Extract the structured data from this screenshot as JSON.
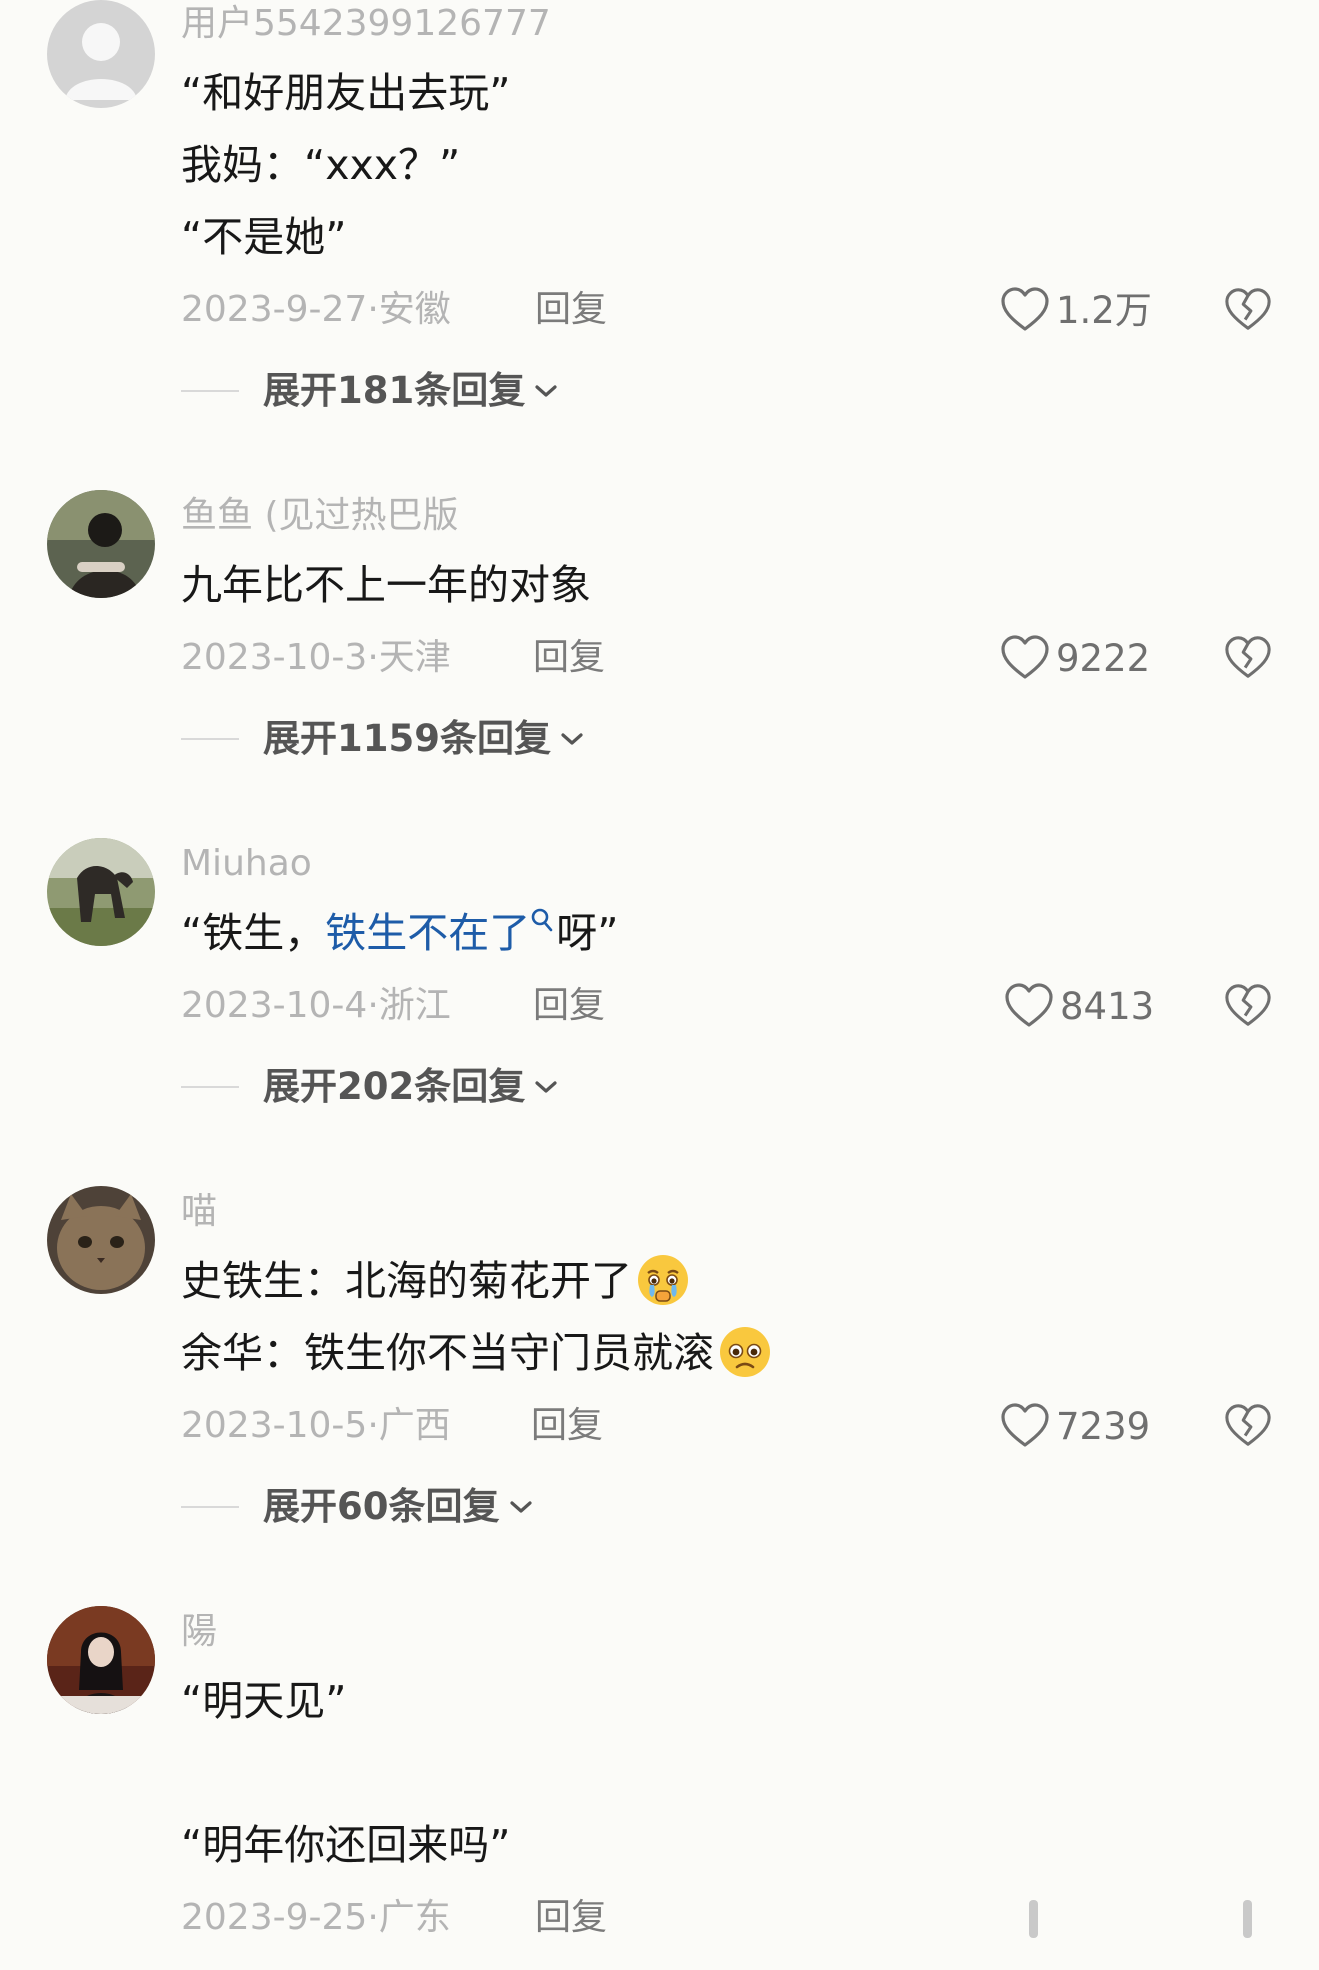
{
  "comments": [
    {
      "username": "用户5542399126777",
      "lines": [
        "“和好朋友出去玩”",
        "我妈：“xxx？”",
        "“不是她”"
      ],
      "date": "2023-9-27",
      "location": "安徽",
      "reply_label": "回复",
      "likes": "1.2万",
      "expand_label": "展开181条回复"
    },
    {
      "username": "鱼鱼 (见过热巴版",
      "lines": [
        "九年比不上一年的对象"
      ],
      "date": "2023-10-3",
      "location": "天津",
      "reply_label": "回复",
      "likes": "9222",
      "expand_label": "展开1159条回复"
    },
    {
      "username": "Miuhao",
      "line_prefix": "“铁生，",
      "line_link": "铁生不在了",
      "line_suffix": "呀”",
      "date": "2023-10-4",
      "location": "浙江",
      "reply_label": "回复",
      "likes": "8413",
      "expand_label": "展开202条回复"
    },
    {
      "username": "喵",
      "lines": [
        "史铁生：北海的菊花开了",
        "余华：铁生你不当守门员就滚"
      ],
      "emojis": [
        "crying-face-emoji",
        "pleading-face-emoji"
      ],
      "date": "2023-10-5",
      "location": "广西",
      "reply_label": "回复",
      "likes": "7239",
      "expand_label": "展开60条回复"
    },
    {
      "username": "陽",
      "lines": [
        "“明天见”",
        "“明年你还回来吗”"
      ],
      "date": "2023-9-25",
      "location": "广东",
      "reply_label": "回复"
    }
  ],
  "icons": {
    "like": "heart-outline-icon",
    "dislike": "broken-heart-icon",
    "expand": "chevron-down-icon",
    "search": "search-icon"
  },
  "colors": {
    "background": "#fbfbf8",
    "text": "#181818",
    "muted": "#b4b4b4",
    "link": "#1e5ca8"
  }
}
